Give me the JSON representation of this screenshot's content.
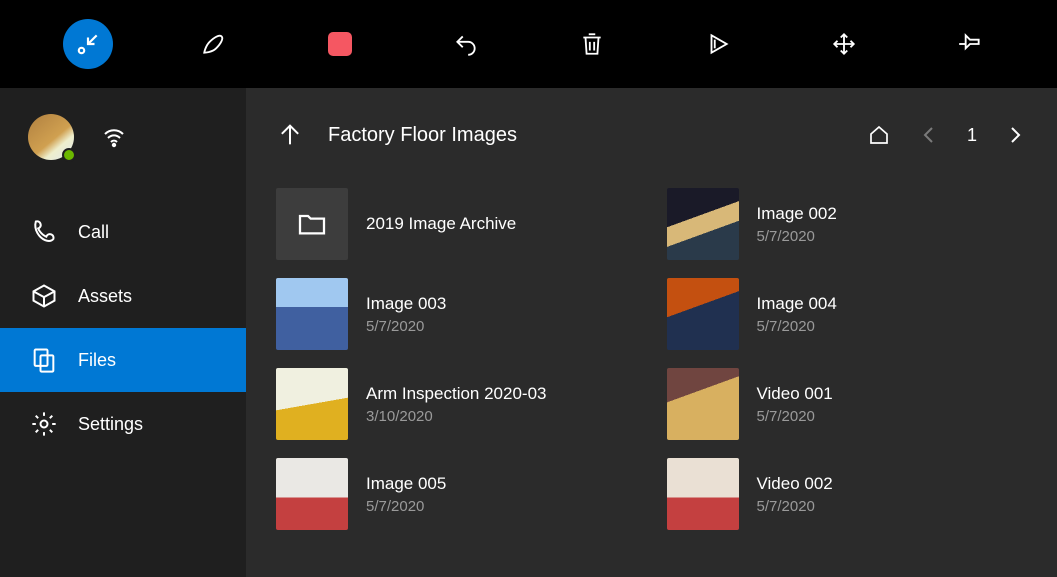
{
  "toolbar": {
    "icons": [
      "shrink-icon",
      "ink-icon",
      "stop-icon",
      "undo-icon",
      "delete-icon",
      "play-icon",
      "move-icon",
      "pin-icon"
    ]
  },
  "sidebar": {
    "items": [
      {
        "label": "Call",
        "icon": "phone-icon",
        "selected": false
      },
      {
        "label": "Assets",
        "icon": "box-icon",
        "selected": false
      },
      {
        "label": "Files",
        "icon": "files-icon",
        "selected": true
      },
      {
        "label": "Settings",
        "icon": "gear-icon",
        "selected": false
      }
    ]
  },
  "header": {
    "title": "Factory Floor Images",
    "page": "1"
  },
  "files": [
    {
      "name": "2019 Image Archive",
      "date": "",
      "type": "folder"
    },
    {
      "name": "Image 002",
      "date": "5/7/2020",
      "thumbClass": "t1"
    },
    {
      "name": "Image 003",
      "date": "5/7/2020",
      "thumbClass": "t2"
    },
    {
      "name": "Image 004",
      "date": "5/7/2020",
      "thumbClass": "t3"
    },
    {
      "name": "Arm Inspection 2020-03",
      "date": "3/10/2020",
      "thumbClass": "t4"
    },
    {
      "name": "Video 001",
      "date": "5/7/2020",
      "thumbClass": "t5"
    },
    {
      "name": "Image 005",
      "date": "5/7/2020",
      "thumbClass": "t6"
    },
    {
      "name": "Video 002",
      "date": "5/7/2020",
      "thumbClass": "t7"
    }
  ]
}
